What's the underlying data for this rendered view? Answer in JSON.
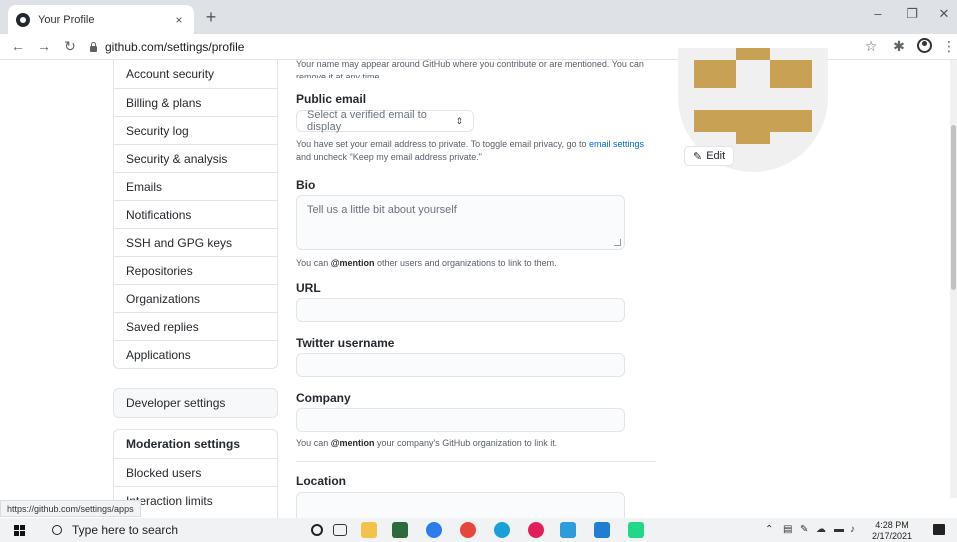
{
  "browser": {
    "tab_title": "Your Profile",
    "tab_close": "×",
    "new_tab": "+",
    "url": "github.com/settings/profile",
    "status_url": "https://github.com/settings/apps"
  },
  "sidebar": {
    "items": [
      "Account security",
      "Billing & plans",
      "Security log",
      "Security & analysis",
      "Emails",
      "Notifications",
      "SSH and GPG keys",
      "Repositories",
      "Organizations",
      "Saved replies",
      "Applications"
    ],
    "developer_settings": "Developer settings",
    "moderation": {
      "heading": "Moderation settings",
      "items": [
        "Blocked users",
        "Interaction limits"
      ]
    }
  },
  "form": {
    "top_note": "Your name may appear around GitHub where you contribute or are mentioned. You can remove it at any time.",
    "public_email_label": "Public email",
    "public_email_placeholder": "Select a verified email to display",
    "email_note_1": "You have set your email address to private. To toggle email privacy, go to ",
    "email_note_link": "email settings",
    "email_note_2": "and uncheck \"Keep my email address private.\"",
    "bio_label": "Bio",
    "bio_placeholder": "Tell us a little bit about yourself",
    "bio_note_pre": "You can ",
    "bio_note_bold": "@mention",
    "bio_note_post": " other users and organizations to link to them.",
    "url_label": "URL",
    "twitter_label": "Twitter username",
    "company_label": "Company",
    "company_note_pre": "You can ",
    "company_note_bold": "@mention",
    "company_note_post": " your company's GitHub organization to link it.",
    "location_label": "Location"
  },
  "avatar": {
    "edit_label": "Edit",
    "identicon_color": "#c9a154"
  },
  "taskbar": {
    "search_placeholder": "Type here to search",
    "time": "4:28 PM",
    "date": "2/17/2021"
  }
}
